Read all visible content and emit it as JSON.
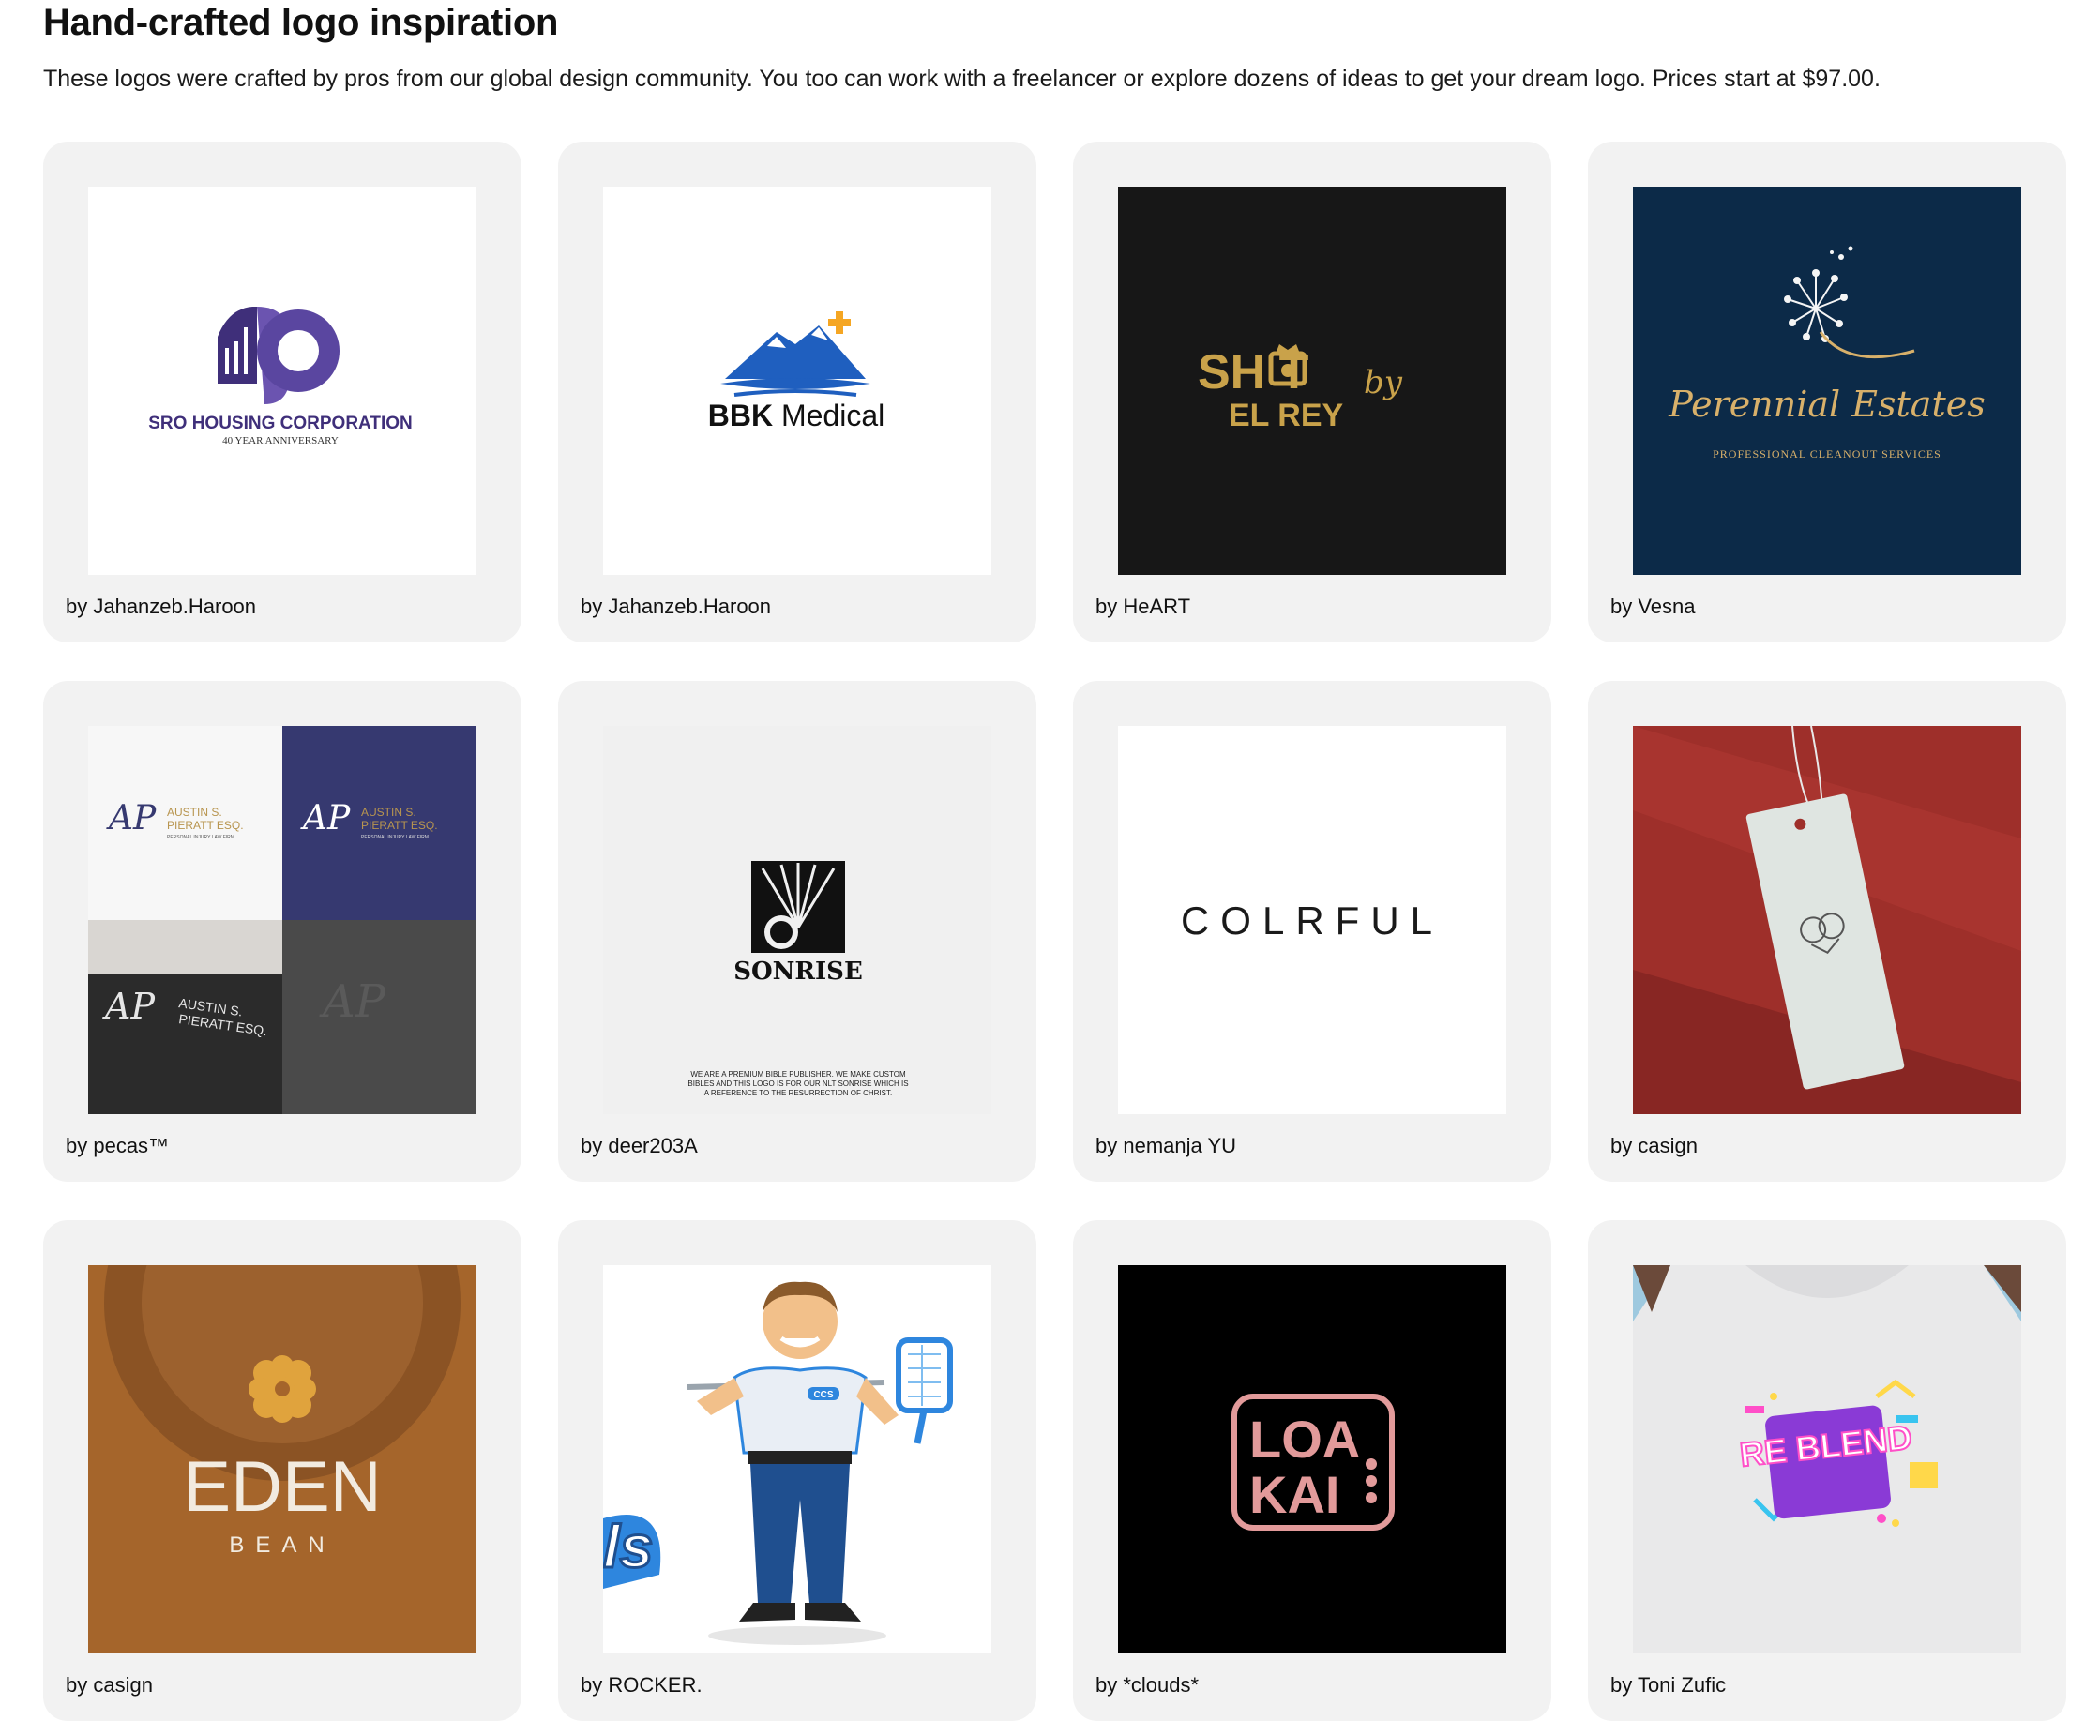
{
  "header": {
    "title": "Hand-crafted logo inspiration",
    "subtitle": "These logos were crafted by pros from our global design community. You too can work with a freelancer or explore dozens of ideas to get your dream logo. Prices start at $97.00."
  },
  "cards": [
    {
      "author": "by Jahanzeb.Haroon",
      "logo": {
        "line1": "SRO HOUSING CORPORATION",
        "line2": "40 YEAR ANNIVERSARY"
      },
      "colors": {
        "bg": "#ffffff",
        "primary": "#3f2f7a",
        "secondary": "#6b54b0"
      }
    },
    {
      "author": "by Jahanzeb.Haroon",
      "logo": {
        "name_bold": "BBK",
        "name_light": " Medical"
      },
      "colors": {
        "bg": "#ffffff",
        "mountain": "#1f5fbf",
        "cross": "#f5a623",
        "text": "#111111"
      }
    },
    {
      "author": "by HeART",
      "logo": {
        "line1": "SH  T",
        "script": "by",
        "line2": "EL REY"
      },
      "colors": {
        "bg": "#121212",
        "gold": "#c9a24a"
      }
    },
    {
      "author": "by Vesna",
      "logo": {
        "name": "Perennial Estates",
        "tagline": "PROFESSIONAL CLEANOUT SERVICES"
      },
      "colors": {
        "bg": "#0c2a48",
        "gold": "#d8b06a",
        "flower": "#f5f5f5"
      }
    },
    {
      "author": "by pecas™",
      "logo": {
        "monogram": "AP",
        "name1": "AUSTIN S.",
        "name2": "PIERATT ESQ.",
        "tagline": "PERSONAL INJURY LAW FIRM"
      },
      "colors": {
        "white": "#f7f7f7",
        "navy": "#363970",
        "gold": "#b8954f",
        "gray": "#4a4a4a"
      }
    },
    {
      "author": "by deer203A",
      "logo": {
        "name": "SONRISE",
        "note1": "WE ARE A PREMIUM BIBLE PUBLISHER. WE MAKE CUSTOM",
        "note2": "BIBLES AND THIS LOGO IS FOR OUR NLT SONRISE WHICH IS",
        "note3": "A REFERENCE TO THE RESURRECTION OF CHRIST."
      },
      "colors": {
        "bg": "#f0f0f0",
        "ink": "#111111"
      }
    },
    {
      "author": "by nemanja YU",
      "logo": {
        "name": "COLRFUL"
      },
      "colors": {
        "bg": "#ffffff",
        "ink": "#1a1a1a"
      }
    },
    {
      "author": "by casign",
      "logo": {
        "type": "hang-tag"
      },
      "colors": {
        "bg": "#9e2f2a",
        "tag": "#dfe5e1"
      }
    },
    {
      "author": "by casign",
      "logo": {
        "name": "EDEN",
        "tagline": "BEAN"
      },
      "colors": {
        "bg": "#a5652b",
        "emblem": "#e0a33d",
        "text": "#f2ebe0"
      }
    },
    {
      "author": "by ROCKER.",
      "logo": {
        "shirt_badge": "CCS"
      },
      "colors": {
        "bg": "#ffffff",
        "shirt": "#e9eef5",
        "accent": "#2e86de",
        "pants": "#1f4f8f"
      }
    },
    {
      "author": "by *clouds*",
      "logo": {
        "line1": "LOA",
        "line2": "KAI"
      },
      "colors": {
        "bg": "#000000",
        "pink": "#e29a9a"
      }
    },
    {
      "author": "by Toni Zufic",
      "logo": {
        "name": "RE BLEND"
      },
      "colors": {
        "bg": "#e9e9ea",
        "purple": "#8a3ad6",
        "pink": "#ff4fc8",
        "yellow": "#ffd84a",
        "cyan": "#39c4ef"
      }
    }
  ]
}
